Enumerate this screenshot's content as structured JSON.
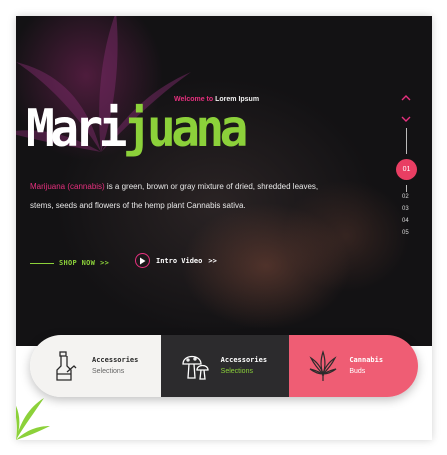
{
  "hero": {
    "welcome_pre": "Welcome to",
    "welcome_post": " Lorem Ipsum",
    "title_white": "Mari",
    "title_green": "juana",
    "desc_highlight": "Marijuana (cannabis)",
    "desc_text": " is a green, brown or gray mixture of dried, shredded leaves, stems, seeds and flowers of the hemp plant Cannabis sativa.",
    "shop_label": "SHOP NOW",
    "shop_arrow": ">>",
    "intro_label": "Intro Video",
    "intro_arrow": ">>"
  },
  "pager": {
    "current": "01",
    "items": [
      "02",
      "03",
      "04",
      "05"
    ]
  },
  "cards": [
    {
      "title": "Accessories",
      "subtitle": "Selections",
      "icon": "bong-icon"
    },
    {
      "title": "Accessories",
      "subtitle": "Selections",
      "icon": "mushroom-icon"
    },
    {
      "title": "Cannabis",
      "subtitle": "Buds",
      "icon": "cannabis-leaf-icon"
    }
  ],
  "colors": {
    "accent_pink": "#e6307e",
    "accent_green": "#8cd13a",
    "card_red": "#ef5d74",
    "card_dark": "#2c2b2d",
    "card_light": "#f4f3f1"
  }
}
